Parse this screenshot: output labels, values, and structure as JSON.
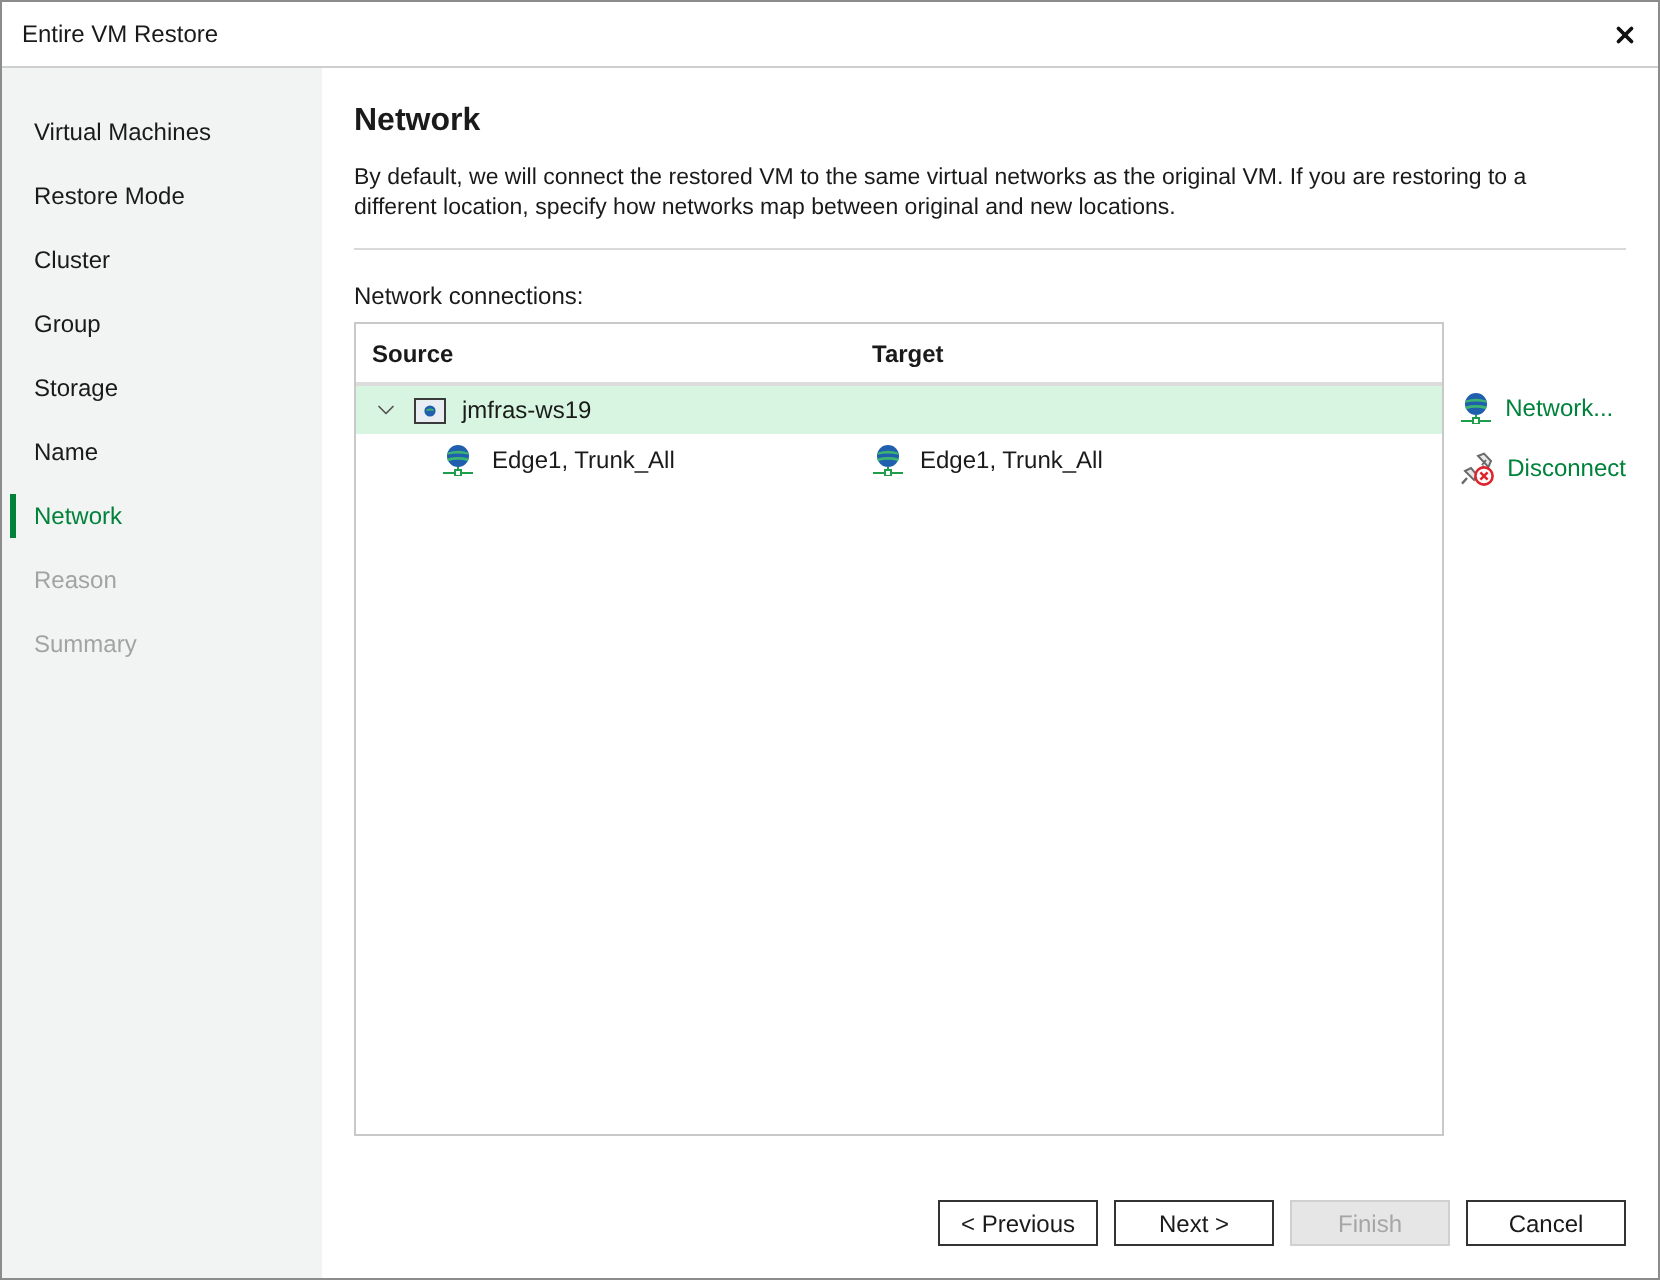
{
  "window": {
    "title": "Entire VM Restore"
  },
  "sidebar": {
    "items": [
      {
        "label": "Virtual Machines",
        "selected": false,
        "disabled": false
      },
      {
        "label": "Restore Mode",
        "selected": false,
        "disabled": false
      },
      {
        "label": "Cluster",
        "selected": false,
        "disabled": false
      },
      {
        "label": "Group",
        "selected": false,
        "disabled": false
      },
      {
        "label": "Storage",
        "selected": false,
        "disabled": false
      },
      {
        "label": "Name",
        "selected": false,
        "disabled": false
      },
      {
        "label": "Network",
        "selected": true,
        "disabled": false
      },
      {
        "label": "Reason",
        "selected": false,
        "disabled": true
      },
      {
        "label": "Summary",
        "selected": false,
        "disabled": true
      }
    ]
  },
  "page": {
    "heading": "Network",
    "description": "By default, we will connect the restored VM to the same virtual networks as the original VM. If you are restoring to a different location, specify how networks map between original and new locations.",
    "section_label": "Network connections:"
  },
  "table": {
    "columns": [
      "Source",
      "Target"
    ],
    "rows": [
      {
        "source": "jmfras-ws19",
        "expanded": true,
        "selected": true,
        "children": [
          {
            "source": "Edge1, Trunk_All",
            "target": "Edge1, Trunk_All",
            "selected": false
          }
        ]
      }
    ]
  },
  "actions": [
    {
      "label": "Network...",
      "kind": "network"
    },
    {
      "label": "Disconnect",
      "kind": "disconnect"
    }
  ],
  "buttons": [
    {
      "label": "< Previous",
      "disabled": false
    },
    {
      "label": "Next >",
      "disabled": false
    },
    {
      "label": "Finish",
      "disabled": true
    },
    {
      "label": "Cancel",
      "disabled": false
    }
  ]
}
